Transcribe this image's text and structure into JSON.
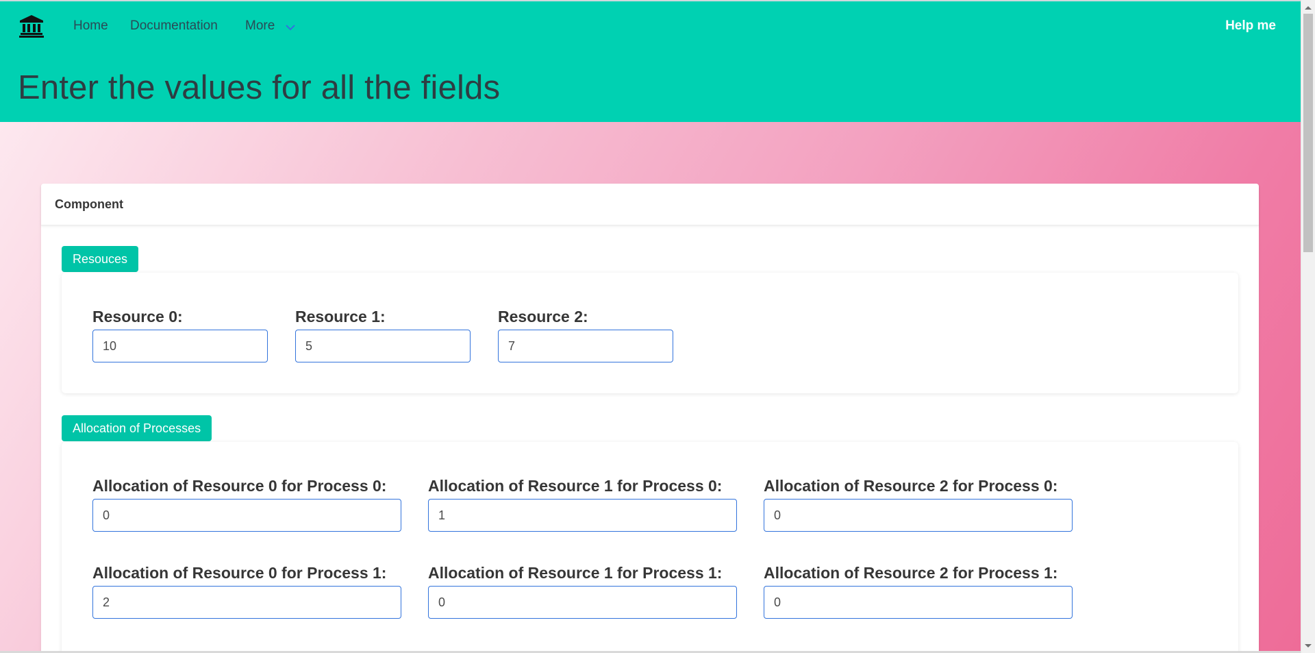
{
  "nav": {
    "home_label": "Home",
    "docs_label": "Documentation",
    "more_label": "More",
    "help_label": "Help me"
  },
  "page": {
    "title": "Enter the values for all the fields"
  },
  "card": {
    "title": "Component"
  },
  "resources": {
    "tag_label": "Resouces",
    "fields": [
      {
        "label": "Resource 0:",
        "value": "10"
      },
      {
        "label": "Resource 1:",
        "value": "5"
      },
      {
        "label": "Resource 2:",
        "value": "7"
      }
    ]
  },
  "allocation": {
    "tag_label": "Allocation of Processes",
    "rows": [
      [
        {
          "label": "Allocation of Resource 0 for Process 0:",
          "value": "0"
        },
        {
          "label": "Allocation of Resource 1 for Process 0:",
          "value": "1"
        },
        {
          "label": "Allocation of Resource 2 for Process 0:",
          "value": "0"
        }
      ],
      [
        {
          "label": "Allocation of Resource 0 for Process 1:",
          "value": "2"
        },
        {
          "label": "Allocation of Resource 1 for Process 1:",
          "value": "0"
        },
        {
          "label": "Allocation of Resource 2 for Process 1:",
          "value": "0"
        }
      ]
    ]
  },
  "colors": {
    "header": "#00d1b2",
    "tag": "#00c4a7",
    "input_border": "#3273dc"
  },
  "icons": {
    "logo": "bank-icon",
    "more": "chevron-down-icon"
  }
}
